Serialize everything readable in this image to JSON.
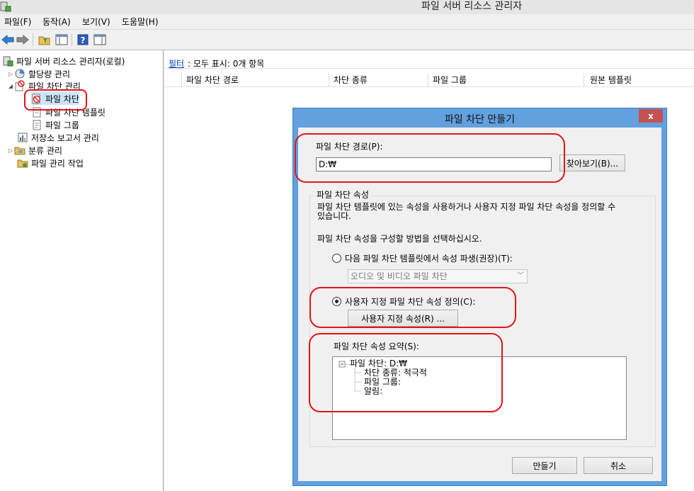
{
  "window": {
    "title": "파일 서버 리소스 관리자"
  },
  "menu": [
    "파일(F)",
    "동작(A)",
    "보기(V)",
    "도움말(H)"
  ],
  "toolbar": {
    "buttons": [
      "back-icon",
      "forward-icon",
      "up-folder-icon",
      "show-hide-tree-icon",
      "help-icon",
      "action-pane-icon"
    ]
  },
  "tree": {
    "root": "파일 서버 리소스 관리자(로컬)",
    "quota": "할당량 관리",
    "screening": "파일 차단 관리",
    "screens": "파일 차단",
    "screen_templates": "파일 차단 템플릿",
    "file_groups": "파일 그룹",
    "storage_reports": "저장소 보고서 관리",
    "classification": "분류 관리",
    "file_tasks": "파일 관리 작업"
  },
  "list": {
    "filter_link": "필터",
    "filter_text": ": 모두 표시: 0개 항목",
    "columns": [
      "파일 차단 경로",
      "차단 종류",
      "파일 그룹",
      "원본 템플릿"
    ]
  },
  "dialog": {
    "title": "파일 차단 만들기",
    "close": "x",
    "path_label": "파일 차단 경로(P):",
    "path_value": "D:₩",
    "browse": "찾아보기(B)...",
    "group_title": "파일 차단 속성",
    "desc_line1": "파일 차단 템플릿에 있는 속성을 사용하거나 사용자 지정 파일 차단 속성을 정의할 수",
    "desc_line2": "있습니다.",
    "choose_text": "파일 차단 속성을 구성할 방법을 선택하십시오.",
    "radio_template": "다음 파일 차단 템플릿에서 속성 파생(권장)(T):",
    "template_value": "오디오 및 비디오 파일 차단",
    "radio_custom": "사용자 지정 파일 차단 속성 정의(C):",
    "custom_button": "사용자 지정 속성(R) ...",
    "summary_label": "파일 차단 속성 요약(S):",
    "summary": {
      "root": "파일 차단: D:₩",
      "type": "차단 종류: 적극적",
      "group": "파일 그룹:",
      "notify": "알림:"
    },
    "create": "만들기",
    "cancel": "취소",
    "selected_option": "custom"
  },
  "colors": {
    "dialog_frame": "#62a0de",
    "highlight": "#e3141c",
    "close": "#c75050"
  }
}
